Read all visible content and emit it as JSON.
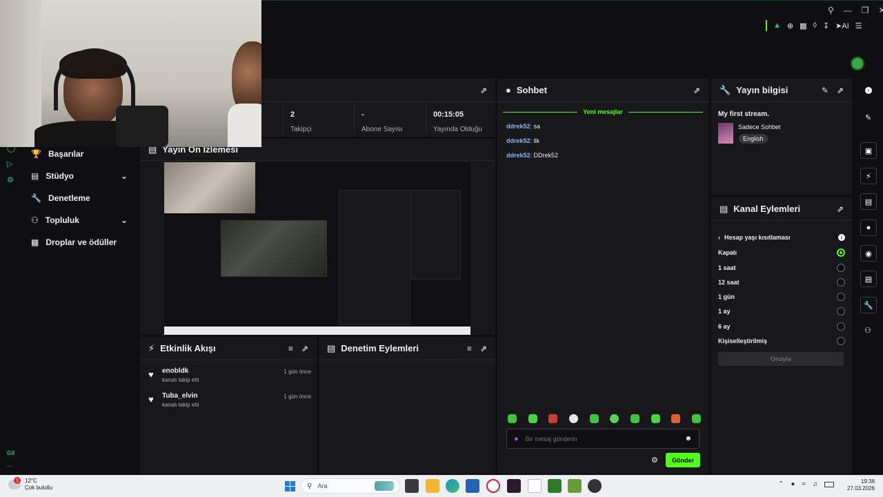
{
  "topbar": {
    "ai_label": "AI"
  },
  "sidebar": {
    "items": [
      {
        "label": "Başarılar",
        "icon": "trophy-icon"
      },
      {
        "label": "Stüdyo",
        "icon": "studio-icon",
        "expandable": true
      },
      {
        "label": "Denetleme",
        "icon": "wrench-icon"
      },
      {
        "label": "Topluluk",
        "icon": "community-icon",
        "expandable": true
      },
      {
        "label": "Droplar ve ödüller",
        "icon": "drops-icon"
      }
    ],
    "footer_badge": "GX",
    "footer_more": "..."
  },
  "stats": [
    {
      "value": "2",
      "label": "Takipçi"
    },
    {
      "value": "-",
      "label": "Abone Sayısı"
    },
    {
      "value": "00:15:05",
      "label": "Yayında Olduğu"
    }
  ],
  "preview": {
    "title": "Yayın Ön İzlemesi"
  },
  "activity": {
    "title": "Etkinlik Akışı",
    "items": [
      {
        "user": "enobldk",
        "desc": "kanalı takip etti",
        "time": "1 gün önce"
      },
      {
        "user": "Tuba_elvin",
        "desc": "kanalı takip etti",
        "time": "1 gün önce"
      }
    ]
  },
  "moderation": {
    "title": "Denetim Eylemleri"
  },
  "chat": {
    "title": "Sohbet",
    "new_messages": "Yeni mesajlar",
    "messages": [
      {
        "user": "ddrek52",
        "text": ": sa"
      },
      {
        "user": "ddrek52",
        "text": ": ilk"
      },
      {
        "user": "ddrek52",
        "text": ": DDrek52"
      }
    ],
    "input_placeholder": "Bir mesaj gönderin",
    "send_label": "Gönder"
  },
  "stream_info": {
    "title": "Yayın bilgisi",
    "stream_title": "My first stream.",
    "category": "Sadece Sohbet",
    "language": "English"
  },
  "channel_actions": {
    "title": "Kanal Eylemleri",
    "sub_title": "Hesap yaşı kısıtlaması",
    "options": [
      "Kapalı",
      "1 saat",
      "12 saat",
      "1 gün",
      "1 ay",
      "6 ay",
      "Kişiselleştirilmiş"
    ],
    "selected": "Kapalı",
    "confirm_label": "Onayla"
  },
  "taskbar": {
    "weather_temp": "12°C",
    "weather_desc": "Çok bulutlu",
    "weather_badge": "1",
    "search_label": "Ara",
    "time": "19:38",
    "date": "27.03.2026"
  },
  "colors": {
    "accent": "#53fc18",
    "background": "#0f0f11",
    "panel": "#18181b"
  }
}
